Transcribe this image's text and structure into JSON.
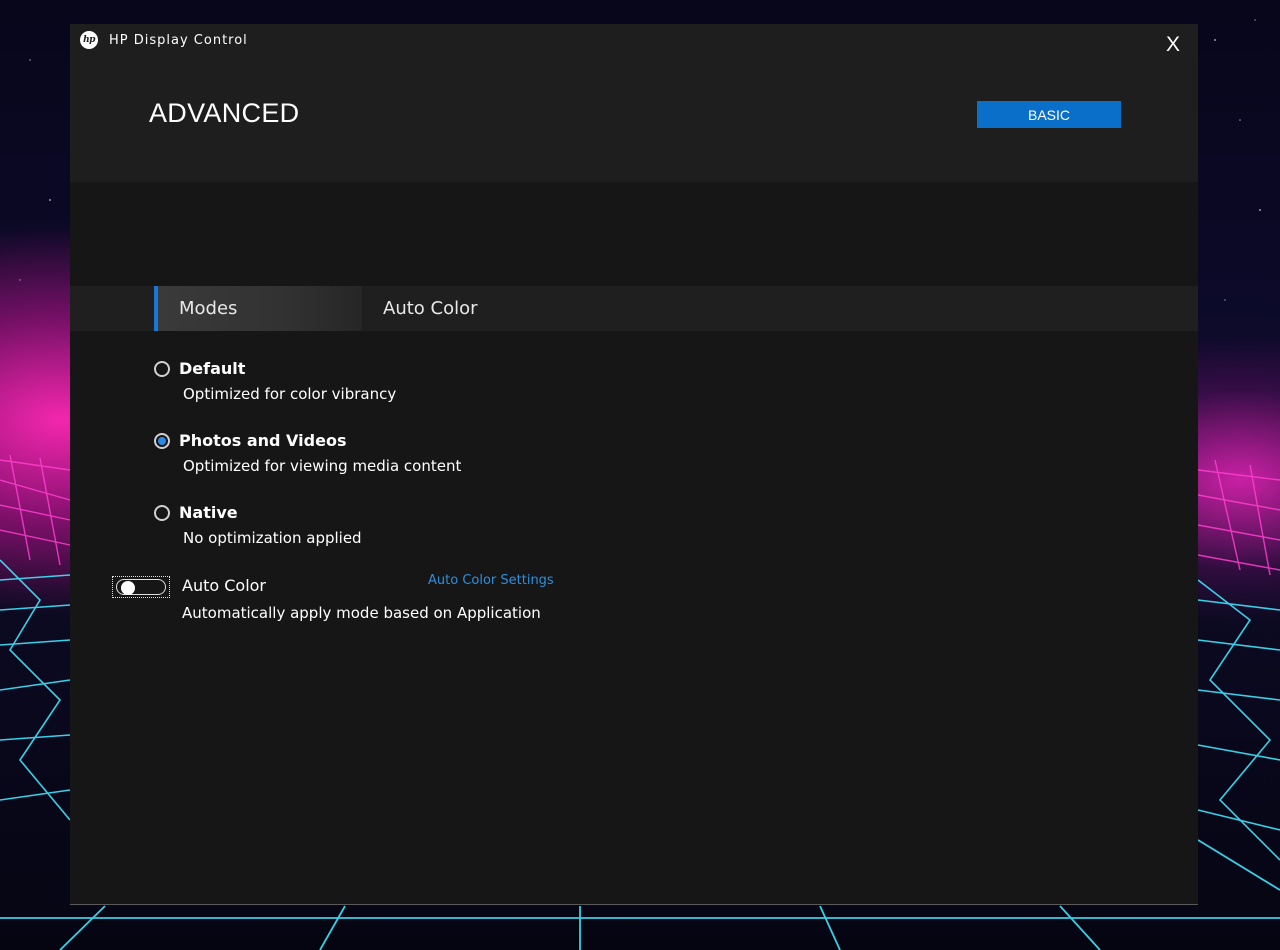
{
  "window": {
    "app_title": "HP Display Control",
    "close_label": "X",
    "page_title": "ADVANCED",
    "basic_button": "BASIC"
  },
  "tabs": [
    {
      "label": "Modes",
      "selected": true
    },
    {
      "label": "Auto Color",
      "selected": false
    }
  ],
  "modes": [
    {
      "label": "Default",
      "description": "Optimized for color vibrancy",
      "selected": false
    },
    {
      "label": "Photos and Videos",
      "description": "Optimized for viewing media content",
      "selected": true
    },
    {
      "label": "Native",
      "description": "No optimization applied",
      "selected": false
    }
  ],
  "auto_color": {
    "label": "Auto Color",
    "description": "Automatically apply mode based on Application",
    "settings_link": "Auto Color Settings",
    "enabled": false
  },
  "icons": {
    "logo": "hp-logo-icon",
    "close": "close-icon"
  },
  "colors": {
    "accent": "#0a6fc9",
    "link": "#2d8fe0",
    "radio_selected": "#2a8ae6",
    "window_bg": "#161616",
    "header_bg": "#1e1e1e"
  }
}
